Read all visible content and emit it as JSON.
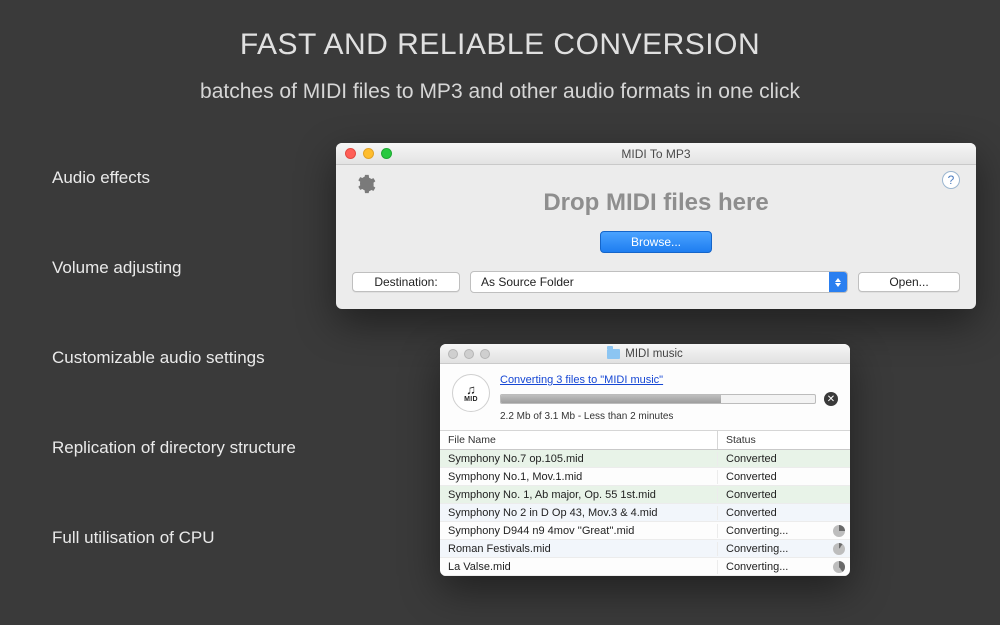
{
  "headline": "FAST AND RELIABLE CONVERSION",
  "subhead": "batches of MIDI files to MP3 and other audio formats in one click",
  "features": [
    "Audio effects",
    "Volume adjusting",
    "Customizable audio settings",
    "Replication of directory structure",
    "Full utilisation of CPU"
  ],
  "win1": {
    "title": "MIDI To MP3",
    "drop_text": "Drop MIDI files here",
    "browse": "Browse...",
    "destination_label": "Destination:",
    "destination_value": "As Source Folder",
    "open": "Open..."
  },
  "win2": {
    "title": "MIDI music",
    "mid_label": "MID",
    "converting_link": "Converting 3 files to \"MIDI music\"",
    "progress_text": "2.2 Mb of 3.1 Mb - Less than 2 minutes",
    "col_filename": "File Name",
    "col_status": "Status",
    "rows": [
      {
        "name": "Symphony No.7 op.105.mid",
        "status": "Converted"
      },
      {
        "name": "Symphony No.1, Mov.1.mid",
        "status": "Converted"
      },
      {
        "name": "Symphony No. 1, Ab major, Op. 55 1st.mid",
        "status": "Converted"
      },
      {
        "name": "Symphony No 2 in D Op 43, Mov.3 & 4.mid",
        "status": "Converted"
      },
      {
        "name": "Symphony D944 n9 4mov ''Great''.mid",
        "status": "Converting..."
      },
      {
        "name": "Roman Festivals.mid",
        "status": "Converting..."
      },
      {
        "name": "La Valse.mid",
        "status": "Converting..."
      }
    ]
  }
}
